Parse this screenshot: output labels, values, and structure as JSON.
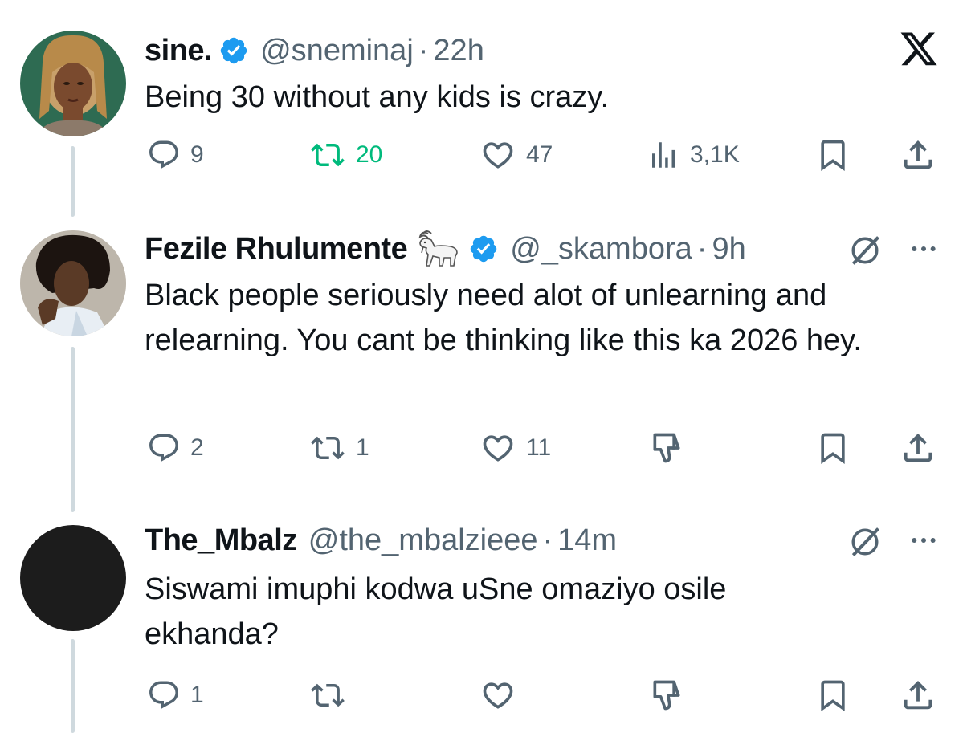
{
  "tweets": [
    {
      "name": "sine.",
      "handle": "@sneminaj",
      "dot": "·",
      "time": "22h",
      "text": "Being 30 without any kids is crazy.",
      "avatar_icon": "profile-photo-woman-braids",
      "replies": "9",
      "retweets": "20",
      "likes": "47",
      "views": "3,1K",
      "retweeted": true
    },
    {
      "name": "Fezile Rhulumente",
      "emoji": "goat-emoji",
      "handle": "@_skambora",
      "dot": "·",
      "time": "9h",
      "text": "Black people seriously need alot of unlearning and relearning. You cant be thinking like this ka 2026 hey.",
      "avatar_icon": "profile-photo-man",
      "replies": "2",
      "retweets": "1",
      "likes": "11",
      "retweeted": false
    },
    {
      "name": "The_Mbalz",
      "handle": "@the_mbalzieee",
      "dot": "·",
      "time": "14m",
      "text": "Siswami imuphi kodwa uSne omaziyo osile ekhanda?",
      "avatar_icon": "profile-photo-dark",
      "replies": "1",
      "retweets": "",
      "likes": "",
      "retweeted": false
    }
  ],
  "colors": {
    "text": "#0f1419",
    "secondary": "#536471",
    "verified": "#1d9bf0",
    "retweet_green": "#00ba7c",
    "thread_line": "#cfd9de"
  },
  "icons": {
    "close": "x-logo-icon",
    "reply": "reply-bubble-icon",
    "retweet": "retweet-icon",
    "like": "heart-icon",
    "views": "views-bar-chart-icon",
    "bookmark": "bookmark-icon",
    "share": "share-upload-icon",
    "dislike": "thumbs-down-icon",
    "grok": "grok-slash-circle-icon",
    "more": "more-dots-icon"
  }
}
